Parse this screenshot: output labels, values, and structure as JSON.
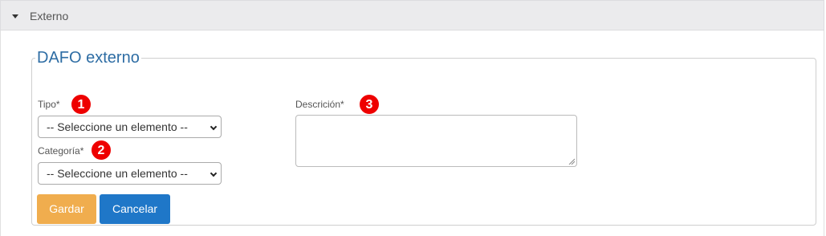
{
  "accordion": {
    "title": "Externo"
  },
  "fieldset": {
    "legend": "DAFO externo"
  },
  "form": {
    "tipo_label": "Tipo",
    "categoria_label": "Categoría",
    "descripcion_label": "Descrición",
    "required_mark": "*",
    "tipo_value": "-- Seleccione un elemento --",
    "categoria_value": "-- Seleccione un elemento --"
  },
  "badges": [
    "1",
    "2",
    "3"
  ],
  "buttons": {
    "save": "Gardar",
    "cancel": "Cancelar"
  },
  "colors": {
    "header_bg": "#ebebed",
    "legend": "#2e6da4",
    "badge": "#ee0000",
    "save_button": "#f0ad4e",
    "cancel_button": "#1f77c8"
  }
}
